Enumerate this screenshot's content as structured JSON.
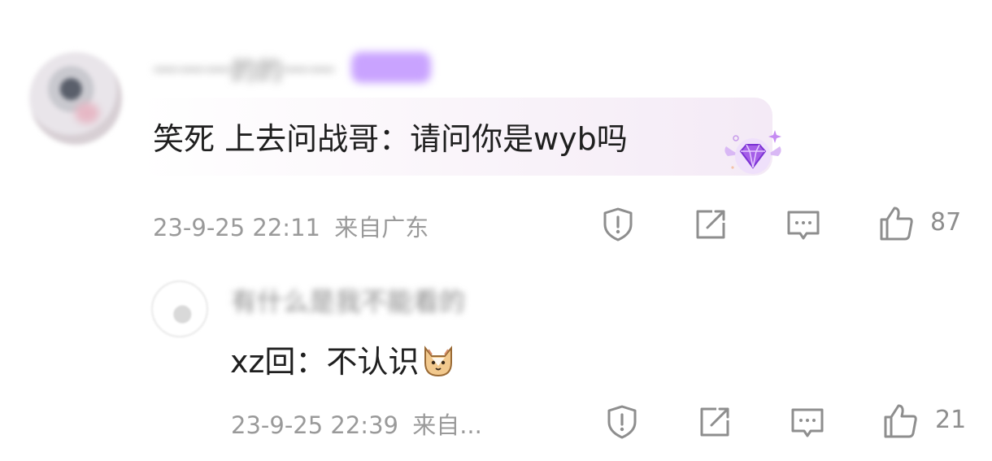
{
  "comments": [
    {
      "username": "一一一的的一一",
      "comment_text": "笑死 上去问战哥：请问你是wyb吗",
      "date": "23-9-25 22:11",
      "location": "来自广东",
      "likes": "87",
      "icons": [
        "report-icon",
        "share-icon",
        "reply-icon",
        "like-icon",
        "diamond-badge-icon"
      ]
    },
    {
      "username": "有什么是我不能看的",
      "comment_text": "xz回：不认识",
      "emoji": "cat-emoji-icon",
      "date": "23-9-25 22:39",
      "location": "来自...",
      "likes": "21",
      "icons": [
        "report-icon",
        "share-icon",
        "reply-icon",
        "like-icon"
      ]
    }
  ],
  "colors": {
    "meta_text": "#9a9a9a",
    "comment_text": "#1f1f1f",
    "bubble_highlight": "#f4eaf6",
    "badge_purple": "#c9a3ff"
  }
}
